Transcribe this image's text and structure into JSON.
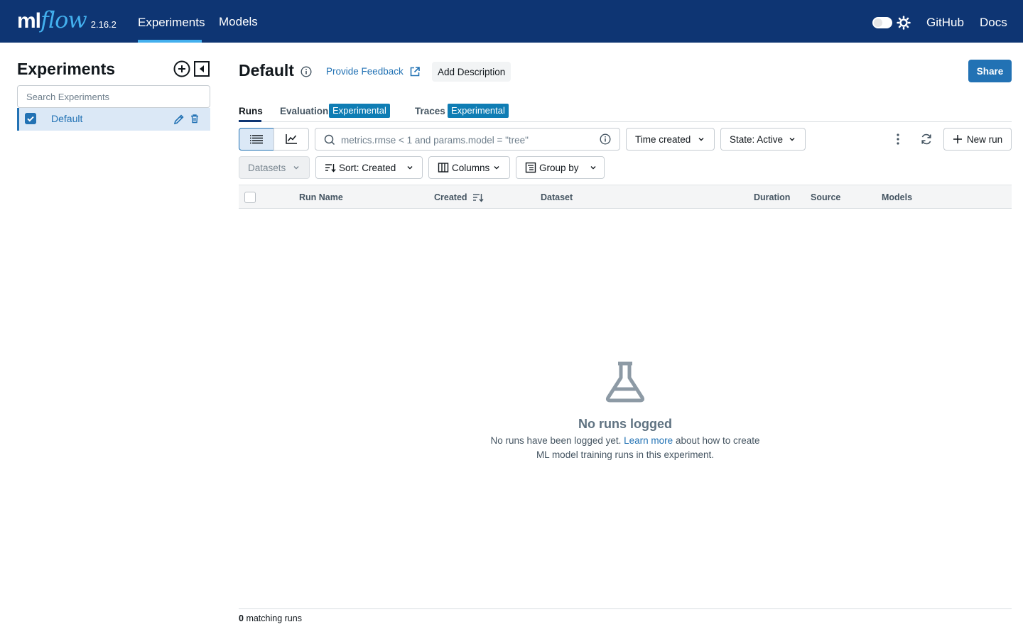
{
  "header": {
    "logo_ml": "ml",
    "logo_flow": "flow",
    "version": "2.16.2",
    "nav": [
      {
        "label": "Experiments",
        "active": true
      },
      {
        "label": "Models",
        "active": false
      }
    ],
    "github": "GitHub",
    "docs": "Docs",
    "colors": {
      "bar": "#0e3573",
      "accent": "#43b0ee"
    }
  },
  "sidebar": {
    "title": "Experiments",
    "search_placeholder": "Search Experiments",
    "experiments": [
      {
        "name": "Default",
        "selected": true
      }
    ]
  },
  "main": {
    "title": "Default",
    "feedback_label": "Provide Feedback",
    "add_description": "Add Description",
    "share": "Share",
    "tabs": [
      {
        "label": "Runs",
        "active": true,
        "badge": ""
      },
      {
        "label": "Evaluation",
        "active": false,
        "badge": "Experimental"
      },
      {
        "label": "Traces",
        "active": false,
        "badge": "Experimental"
      }
    ],
    "search_placeholder": "metrics.rmse < 1 and params.model = \"tree\"",
    "time_filter": "Time created",
    "state_filter": "State: Active",
    "new_run": "New run",
    "datasets": "Datasets",
    "sort": "Sort: Created",
    "columns": "Columns",
    "group_by": "Group by",
    "table_headers": [
      "Run Name",
      "Created",
      "Dataset",
      "Duration",
      "Source",
      "Models"
    ],
    "empty": {
      "title": "No runs logged",
      "text_before": "No runs have been logged yet.",
      "link": "Learn more",
      "text_after": "about how to create ML model training runs in this experiment."
    },
    "footer_count": "0",
    "footer_label": "matching runs"
  }
}
